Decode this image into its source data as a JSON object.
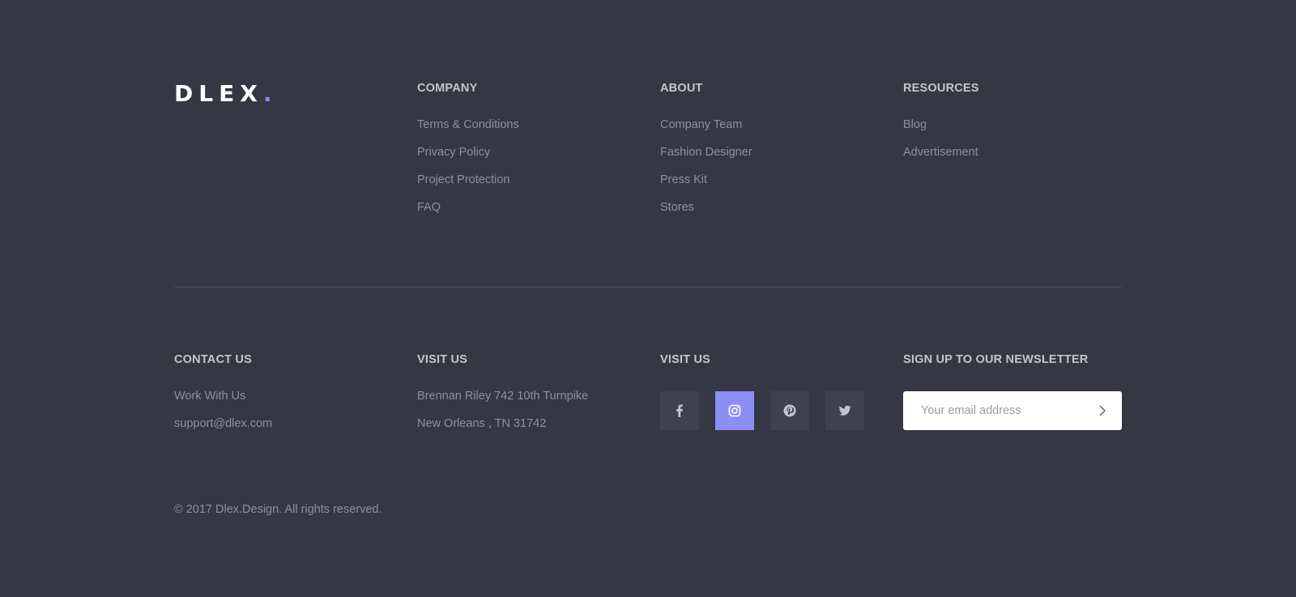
{
  "brand": {
    "logo_text": "DLEX",
    "logo_dot": ".",
    "accent_color": "#8b8ef5"
  },
  "top_columns": [
    {
      "heading": "COMPANY",
      "links": [
        "Terms & Conditions",
        "Privacy Policy",
        "Project Protection",
        "FAQ"
      ]
    },
    {
      "heading": "ABOUT",
      "links": [
        "Company Team",
        "Fashion Designer",
        "Press Kit",
        "Stores"
      ]
    },
    {
      "heading": "RESOURCES",
      "links": [
        "Blog",
        "Advertisement"
      ]
    }
  ],
  "contact": {
    "heading": "CONTACT US",
    "links": [
      "Work With Us",
      "support@dlex.com"
    ]
  },
  "visit": {
    "heading": "VISIT US",
    "address_line1": "Brennan Riley 742 10th Turnpike",
    "address_line2": "New Orleans , TN 31742"
  },
  "social": {
    "heading": "VISIT US",
    "icons": [
      "facebook-icon",
      "instagram-icon",
      "pinterest-icon",
      "twitter-icon"
    ],
    "active_icon": "instagram-icon"
  },
  "newsletter": {
    "heading": "SIGN UP TO OUR NEWSLETTER",
    "placeholder": "Your email address",
    "submit_icon": "chevron-right-icon"
  },
  "copyright": "© 2017 Dlex.Design. All rights reserved.",
  "colors": {
    "background": "#363745",
    "heading": "#c3c4cf",
    "link": "#8e8f9e",
    "social_bg": "#3f4050",
    "divider": "#4a4b5a"
  }
}
